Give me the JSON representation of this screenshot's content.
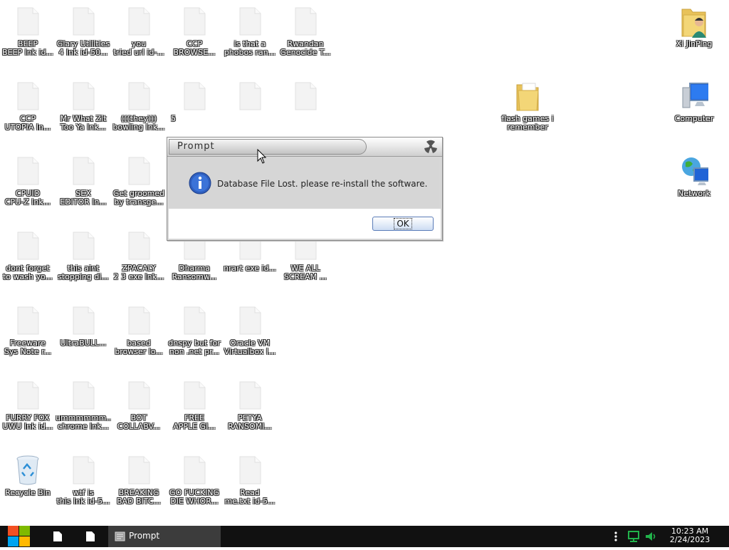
{
  "desktop": {
    "icons": [
      {
        "label": "BEEP\nBEEP lnk id...",
        "kind": "doc"
      },
      {
        "label": "Glary Utilities\n4 lnk id-50...",
        "kind": "doc"
      },
      {
        "label": "you\ntried url id-...",
        "kind": "doc"
      },
      {
        "label": "CCP\nBROWSE...",
        "kind": "doc"
      },
      {
        "label": "is that a\nphobos ran...",
        "kind": "doc"
      },
      {
        "label": "Rwandan\nGenocide T...",
        "kind": "doc"
      },
      {
        "label": "CCP\nUTOPIA ln...",
        "kind": "doc"
      },
      {
        "label": "Mr What Zit\nToo Ya lnk...",
        "kind": "doc"
      },
      {
        "label": "(((they)))\nbowling lnk...",
        "kind": "doc"
      },
      {
        "label": "5",
        "kind": "doc"
      },
      {
        "label": "",
        "kind": "doc"
      },
      {
        "label": "",
        "kind": "doc"
      },
      {
        "label": "CPUID\nCPU-Z lnk...",
        "kind": "doc"
      },
      {
        "label": "SEX\nEDITOR ln...",
        "kind": "doc"
      },
      {
        "label": "Get groomed\nby transge...",
        "kind": "doc"
      },
      {
        "label": "dont forget\nto wash yo...",
        "kind": "doc"
      },
      {
        "label": "this aint\nstopping di...",
        "kind": "doc"
      },
      {
        "label": "ZPACALY\n2 3 exe lnk...",
        "kind": "doc"
      },
      {
        "label": "Dharma\nRansomw...",
        "kind": "doc"
      },
      {
        "label": "nrart exe id...",
        "kind": "doc"
      },
      {
        "label": "WE ALL\nSCREAM ...",
        "kind": "doc"
      },
      {
        "label": "Freeware\nSys Note r...",
        "kind": "doc"
      },
      {
        "label": "UltraBULL...",
        "kind": "doc"
      },
      {
        "label": "based\nbrowser lo...",
        "kind": "doc"
      },
      {
        "label": "dnspy but for\nnon .net pr...",
        "kind": "doc"
      },
      {
        "label": "Oracle VM\nVirtualbox l...",
        "kind": "doc"
      },
      {
        "label": "FURRY FOX\nUWU lnk id...",
        "kind": "doc"
      },
      {
        "label": "ummmmmm...\nchrome lnk...",
        "kind": "doc"
      },
      {
        "label": "BOT\nCOLLABV...",
        "kind": "doc"
      },
      {
        "label": "FREE\nAPPLE GI...",
        "kind": "doc"
      },
      {
        "label": "PETYA\nRANSOMI...",
        "kind": "doc"
      },
      {
        "label": "Recycle Bin",
        "kind": "recycle"
      },
      {
        "label": "wtf is\nthis lnk id-5...",
        "kind": "doc"
      },
      {
        "label": "BREAKING\nBAD BITC...",
        "kind": "doc"
      },
      {
        "label": "GO FUCKING\nDIE WHOR...",
        "kind": "doc"
      },
      {
        "label": "Read\nme.txt id-5...",
        "kind": "doc"
      },
      {
        "label": "flash games i\nremember",
        "kind": "folder"
      },
      {
        "label": "Xi JinPing",
        "kind": "userfolder"
      },
      {
        "label": "Computer",
        "kind": "computer"
      },
      {
        "label": "Network",
        "kind": "network"
      }
    ]
  },
  "dialog": {
    "title": "Prompt",
    "message": "Database File Lost. please re-install the software.",
    "ok_label": "OK"
  },
  "taskbar": {
    "task_label": "Prompt",
    "time": "10:23 AM",
    "date": "2/24/2023"
  },
  "colors": {
    "taskbar": "#111111",
    "task_active": "#3c3c3c",
    "win_red": "#f25022",
    "win_green": "#7fba00",
    "win_blue": "#00a4ef",
    "win_yellow": "#ffb900"
  }
}
